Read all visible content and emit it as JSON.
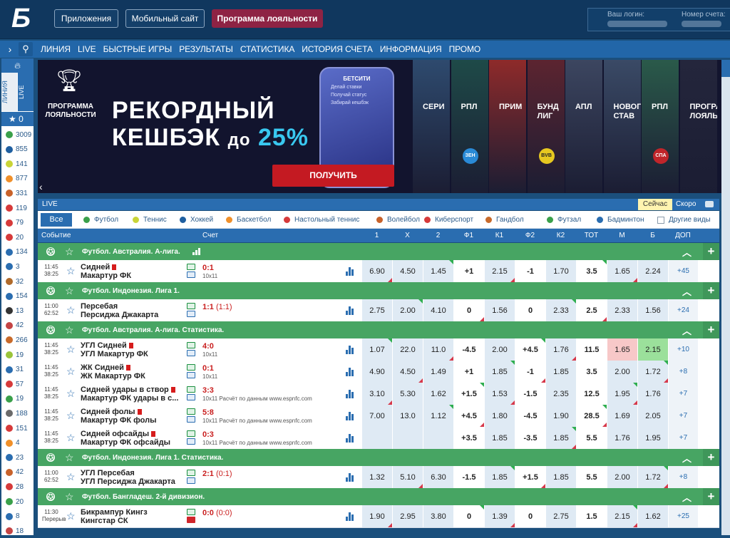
{
  "header": {
    "logo": "Б",
    "buttons": [
      "Приложения",
      "Мобильный сайт",
      "Программа лояльности"
    ],
    "login_label": "Ваш логин:",
    "account_label": "Номер счета:"
  },
  "nav": {
    "items": [
      "ЛИНИЯ",
      "LIVE",
      "БЫСТРЫЕ ИГРЫ",
      "РЕЗУЛЬТАТЫ",
      "СТАТИСТИКА",
      "ИСТОРИЯ СЧЕТА",
      "ИНФОРМАЦИЯ",
      "ПРОМО"
    ]
  },
  "sidebar": {
    "tab_line": "ЛИНИЯ",
    "tab_live": "LIVE",
    "favorites": "0",
    "counts": [
      "3009",
      "855",
      "141",
      "877",
      "331",
      "119",
      "79",
      "20",
      "134",
      "3",
      "32",
      "154",
      "13",
      "42",
      "266",
      "19",
      "31",
      "57",
      "19",
      "188",
      "151",
      "4",
      "23",
      "42",
      "28",
      "20",
      "8",
      "18"
    ],
    "colors": [
      "#3aa04a",
      "#1f5fa0",
      "#c9d437",
      "#f0902a",
      "#c8622a",
      "#d63a3a",
      "#d63a3a",
      "#d63a3a",
      "#2a6db0",
      "#2a6db0",
      "#b06a2a",
      "#2a6db0",
      "#333333",
      "#c44444",
      "#c86a2a",
      "#9ac43a",
      "#2a6db0",
      "#d63a3a",
      "#3aa04a",
      "#6a6a6a",
      "#d63a3a",
      "#f0902a",
      "#2a6db0",
      "#c8622a",
      "#d63a3a",
      "#3aa04a",
      "#2a6db0",
      "#c44444"
    ]
  },
  "banner": {
    "loyalty": "ПРОГРАММА ЛОЯЛЬНОСТИ",
    "headline1": "РЕКОРДНЫЙ",
    "headline2a": "КЕШБЭК",
    "headline2b": "до",
    "headline2c": "25%",
    "phone_title": "БЕТСИТИ",
    "phone_lines": [
      "Делай ставки",
      "Получай статус",
      "Забирай кешбэк"
    ],
    "cta": "ПОЛУЧИТЬ",
    "cards": [
      {
        "t": "СЕРИ",
        "b": "",
        "c": "#2e4a6e"
      },
      {
        "t": "РПЛ",
        "b": "ЗЕН",
        "c": "#1e4a48"
      },
      {
        "t": "ПРИМ",
        "b": "",
        "c": "#8e2a2a"
      },
      {
        "t": "БУНД\nЛИГ",
        "b": "BVB",
        "c": "#5c2430"
      },
      {
        "t": "АПЛ",
        "b": "",
        "c": "#3c4660"
      },
      {
        "t": "НОВОГО\nСТАВ",
        "b": "",
        "c": "#3a4a66"
      },
      {
        "t": "РПЛ",
        "b": "СПА",
        "c": "#2a5a4a"
      },
      {
        "t": "ПРОГРА\nЛОЯЛЬ",
        "b": "",
        "c": "#24263c"
      }
    ]
  },
  "live": {
    "title": "LIVE",
    "now": "Сейчас",
    "soon": "Скоро"
  },
  "filters": {
    "all": "Все",
    "sports": [
      {
        "n": "Футбол",
        "c": "#3aa04a"
      },
      {
        "n": "Теннис",
        "c": "#c9d437"
      },
      {
        "n": "Хоккей",
        "c": "#1f5fa0"
      },
      {
        "n": "Баскетбол",
        "c": "#f0902a"
      },
      {
        "n": "Настольный теннис",
        "c": "#d63a3a"
      },
      {
        "n": "Волейбол",
        "c": "#c8622a"
      },
      {
        "n": "Киберспорт",
        "c": "#d63a3a"
      },
      {
        "n": "Гандбол",
        "c": "#c86a2a"
      },
      {
        "n": "Футзал",
        "c": "#3aa04a"
      },
      {
        "n": "Бадминтон",
        "c": "#2a6db0"
      }
    ],
    "other": "Другие виды"
  },
  "table": {
    "cols": [
      "Событие",
      "Счет",
      "1",
      "X",
      "2",
      "Ф1",
      "К1",
      "Ф2",
      "К2",
      "ТОТ",
      "М",
      "Б",
      "ДОП"
    ],
    "groups": [
      {
        "name": "Футбол. Австралия. А-лига.",
        "rows": [
          {
            "time": "11:45",
            "clock": "38:25",
            "t1": "Сидней",
            "t2": "Макартур ФК",
            "red1": true,
            "score": "0:1",
            "sub": "10x11",
            "yt": false,
            "odds": [
              "6.90",
              "4.50",
              "1.45",
              "+1",
              "2.15",
              "-1",
              "1.70",
              "3.5",
              "1.65",
              "2.24",
              "+45"
            ]
          }
        ]
      },
      {
        "name": "Футбол. Индонезия. Лига 1.",
        "rows": [
          {
            "time": "11:00",
            "clock": "62:52",
            "t1": "Персебая",
            "t2": "Персиджа Джакарта",
            "score": "1:1",
            "scorex": "(1:1)",
            "sub": "",
            "odds": [
              "2.75",
              "2.00",
              "4.10",
              "0",
              "1.56",
              "0",
              "2.33",
              "2.5",
              "2.33",
              "1.56",
              "+24"
            ]
          }
        ]
      },
      {
        "name": "Футбол. Австралия. А-лига. Статистика.",
        "rows": [
          {
            "time": "11:45",
            "clock": "38:25",
            "t1": "УГЛ Сидней",
            "t2": "УГЛ Макартур ФК",
            "red1": true,
            "score": "4:0",
            "sub": "10x11",
            "odds": [
              "1.07",
              "22.0",
              "11.0",
              "-4.5",
              "2.00",
              "+4.5",
              "1.76",
              "11.5",
              "1.65",
              "2.15",
              "+10"
            ],
            "hl": true
          },
          {
            "time": "11:45",
            "clock": "38:25",
            "t1": "ЖК Сидней",
            "t2": "ЖК Макартур ФК",
            "red1": true,
            "score": "0:1",
            "sub": "10x11",
            "odds": [
              "4.90",
              "4.50",
              "1.49",
              "+1",
              "1.85",
              "-1",
              "1.85",
              "3.5",
              "2.00",
              "1.72",
              "+8"
            ]
          },
          {
            "time": "11:45",
            "clock": "38:25",
            "t1": "Сидней удары в створ",
            "t2": "Макартур ФК удары в с...",
            "red1": true,
            "score": "3:3",
            "sub": "10x11 Расчёт по данным www.espnfc.com",
            "odds": [
              "3.10",
              "5.30",
              "1.62",
              "+1.5",
              "1.53",
              "-1.5",
              "2.35",
              "12.5",
              "1.95",
              "1.76",
              "+7"
            ]
          },
          {
            "time": "11:45",
            "clock": "38:25",
            "t1": "Сидней фолы",
            "t2": "Макартур ФК фолы",
            "red1": true,
            "score": "5:8",
            "sub": "10x11 Расчёт по данным www.espnfc.com",
            "odds": [
              "7.00",
              "13.0",
              "1.12",
              "+4.5",
              "1.80",
              "-4.5",
              "1.90",
              "28.5",
              "1.69",
              "2.05",
              "+7"
            ]
          },
          {
            "time": "11:45",
            "clock": "38:25",
            "t1": "Сидней офсайды",
            "t2": "Макартур ФК офсайды",
            "red1": true,
            "score": "0:3",
            "sub": "10x11 Расчёт по данным www.espnfc.com",
            "odds": [
              "",
              "",
              "",
              "+3.5",
              "1.85",
              "-3.5",
              "1.85",
              "5.5",
              "1.76",
              "1.95",
              "+7"
            ]
          }
        ]
      },
      {
        "name": "Футбол. Индонезия. Лига 1. Статистика.",
        "rows": [
          {
            "time": "11:00",
            "clock": "62:52",
            "t1": "УГЛ Персебая",
            "t2": "УГЛ Персиджа Джакарта",
            "score": "2:1",
            "scorex": "(0:1)",
            "sub": "",
            "odds": [
              "1.32",
              "5.10",
              "6.30",
              "-1.5",
              "1.85",
              "+1.5",
              "1.85",
              "5.5",
              "2.00",
              "1.72",
              "+8"
            ]
          }
        ]
      },
      {
        "name": "Футбол. Бангладеш. 2-й дивизион.",
        "rows": [
          {
            "time": "11:30",
            "clock": "Перерыв",
            "t1": "Бикрампур Кингз",
            "t2": "Кингстар СК",
            "score": "0:0",
            "scorex": "(0:0)",
            "sub": "",
            "yt": true,
            "odds": [
              "1.90",
              "2.95",
              "3.80",
              "0",
              "1.39",
              "0",
              "2.75",
              "1.5",
              "2.15",
              "1.62",
              "+25"
            ]
          }
        ]
      }
    ]
  }
}
